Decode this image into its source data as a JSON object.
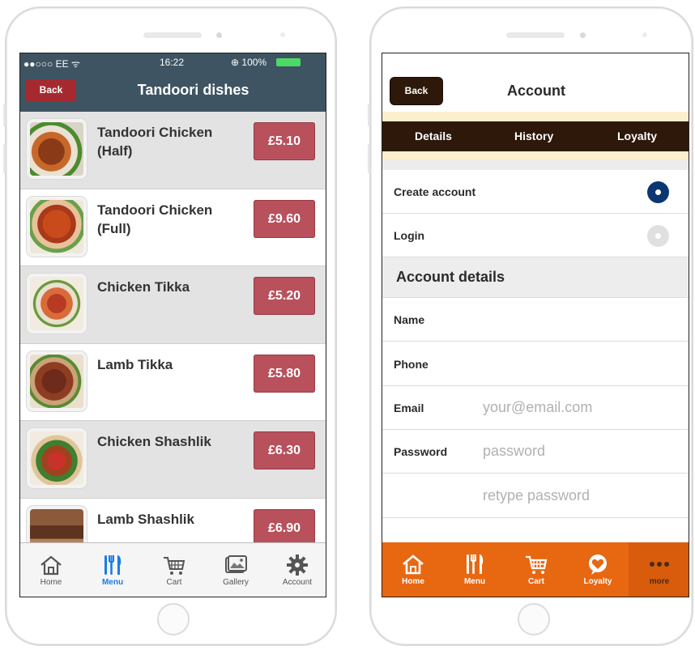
{
  "left": {
    "status": {
      "carrier": "●●○○○ EE ᯤ",
      "time": "16:22",
      "battery": "⊕ 100%"
    },
    "header": {
      "back_label": "Back",
      "title": "Tandoori dishes"
    },
    "dishes": [
      {
        "name": "Tandoori Chicken (Half)",
        "price": "£5.10",
        "shade": "alt"
      },
      {
        "name": "Tandoori Chicken (Full)",
        "price": "£9.60",
        "shade": "white"
      },
      {
        "name": "Chicken Tikka",
        "price": "£5.20",
        "shade": "alt"
      },
      {
        "name": "Lamb Tikka",
        "price": "£5.80",
        "shade": "white"
      },
      {
        "name": "Chicken Shashlik",
        "price": "£6.30",
        "shade": "alt"
      },
      {
        "name": "Lamb Shashlik",
        "price": "£6.90",
        "shade": "white"
      }
    ],
    "tabs": [
      {
        "label": "Home",
        "icon": "home-icon"
      },
      {
        "label": "Menu",
        "icon": "cutlery-icon",
        "active": true
      },
      {
        "label": "Cart",
        "icon": "cart-icon"
      },
      {
        "label": "Gallery",
        "icon": "gallery-icon"
      },
      {
        "label": "Account",
        "icon": "gear-icon"
      }
    ]
  },
  "right": {
    "header": {
      "back_label": "Back",
      "title": "Account"
    },
    "segments": [
      "Details",
      "History",
      "Loyalty"
    ],
    "options": [
      {
        "label": "Create account",
        "selected": true
      },
      {
        "label": "Login",
        "selected": false
      }
    ],
    "section_title": "Account details",
    "fields": [
      {
        "label": "Name",
        "placeholder": ""
      },
      {
        "label": "Phone",
        "placeholder": ""
      },
      {
        "label": "Email",
        "placeholder": "your@email.com"
      },
      {
        "label": "Password",
        "placeholder": "password"
      },
      {
        "label": "",
        "placeholder": "retype password"
      }
    ],
    "tabs": [
      {
        "label": "Home",
        "icon": "home-icon"
      },
      {
        "label": "Menu",
        "icon": "cutlery-icon"
      },
      {
        "label": "Cart",
        "icon": "cart-icon"
      },
      {
        "label": "Loyalty",
        "icon": "heart-icon"
      },
      {
        "label": "more",
        "icon": "more-icon"
      }
    ]
  },
  "colors": {
    "left_header": "#3e5462",
    "back_red": "#a52a2f",
    "price": "#b8515c",
    "active_tab": "#1a7be6",
    "right_dark": "#2d180a",
    "cream": "#fdefcd",
    "orange": "#e86711",
    "radio_on": "#0c3672"
  }
}
